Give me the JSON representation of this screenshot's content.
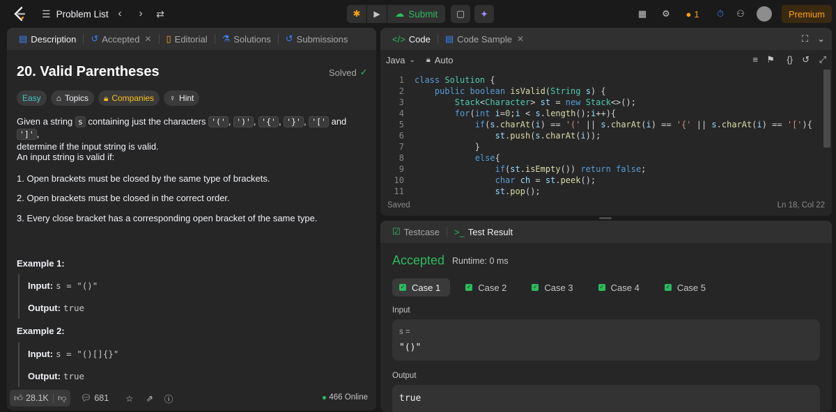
{
  "topbar": {
    "problem_list": "Problem List",
    "submit": "Submit",
    "streak": "1",
    "premium": "Premium"
  },
  "desc_tabs": [
    "Description",
    "Accepted",
    "Editorial",
    "Solutions",
    "Submissions"
  ],
  "problem": {
    "title": "20. Valid Parentheses",
    "status": "Solved",
    "chips": {
      "easy": "Easy",
      "topics": "Topics",
      "companies": "Companies",
      "hint": "Hint"
    },
    "p1_a": "Given a string",
    "p1_s": "s",
    "p1_b": "containing just the characters",
    "c1": "'('",
    "c2": "')'",
    "c3": "'{'",
    "c4": "'}'",
    "c5": "'['",
    "and": "and",
    "c6": "']'",
    "p1_c": "determine if the input string is valid.",
    "p2": "An input string is valid if:",
    "rule1": "1. Open brackets must be closed by the same type of brackets.",
    "rule2": "2. Open brackets must be closed in the correct order.",
    "rule3": "3. Every close bracket has a corresponding open bracket of the same type.",
    "example1_title": "Example 1:",
    "example1_input": "s = \"()\"",
    "example1_output": "true",
    "example2_title": "Example 2:",
    "example2_input": "s = \"()[]{}\"",
    "example2_output": "true",
    "input_label": "Input:",
    "output_label": "Output:"
  },
  "desc_footer": {
    "likes": "28.1K",
    "comments": "681",
    "online": "466 Online"
  },
  "code_tabs": [
    "Code",
    "Code Sample"
  ],
  "code_tool": {
    "language": "Java",
    "auto": "Auto"
  },
  "code_footer": {
    "saved": "Saved",
    "position": "Ln 18, Col 22"
  },
  "line_numbers": [
    "1",
    "2",
    "3",
    "4",
    "5",
    "6",
    "7",
    "8",
    "9",
    "10",
    "11"
  ],
  "result_tabs": [
    "Testcase",
    "Test Result"
  ],
  "result": {
    "verdict": "Accepted",
    "runtime": "Runtime: 0 ms",
    "cases": [
      "Case 1",
      "Case 2",
      "Case 3",
      "Case 4",
      "Case 5"
    ],
    "input_label": "Input",
    "var_label": "s =",
    "input_value": "\"()\"",
    "output_label": "Output",
    "output_value": "true"
  }
}
